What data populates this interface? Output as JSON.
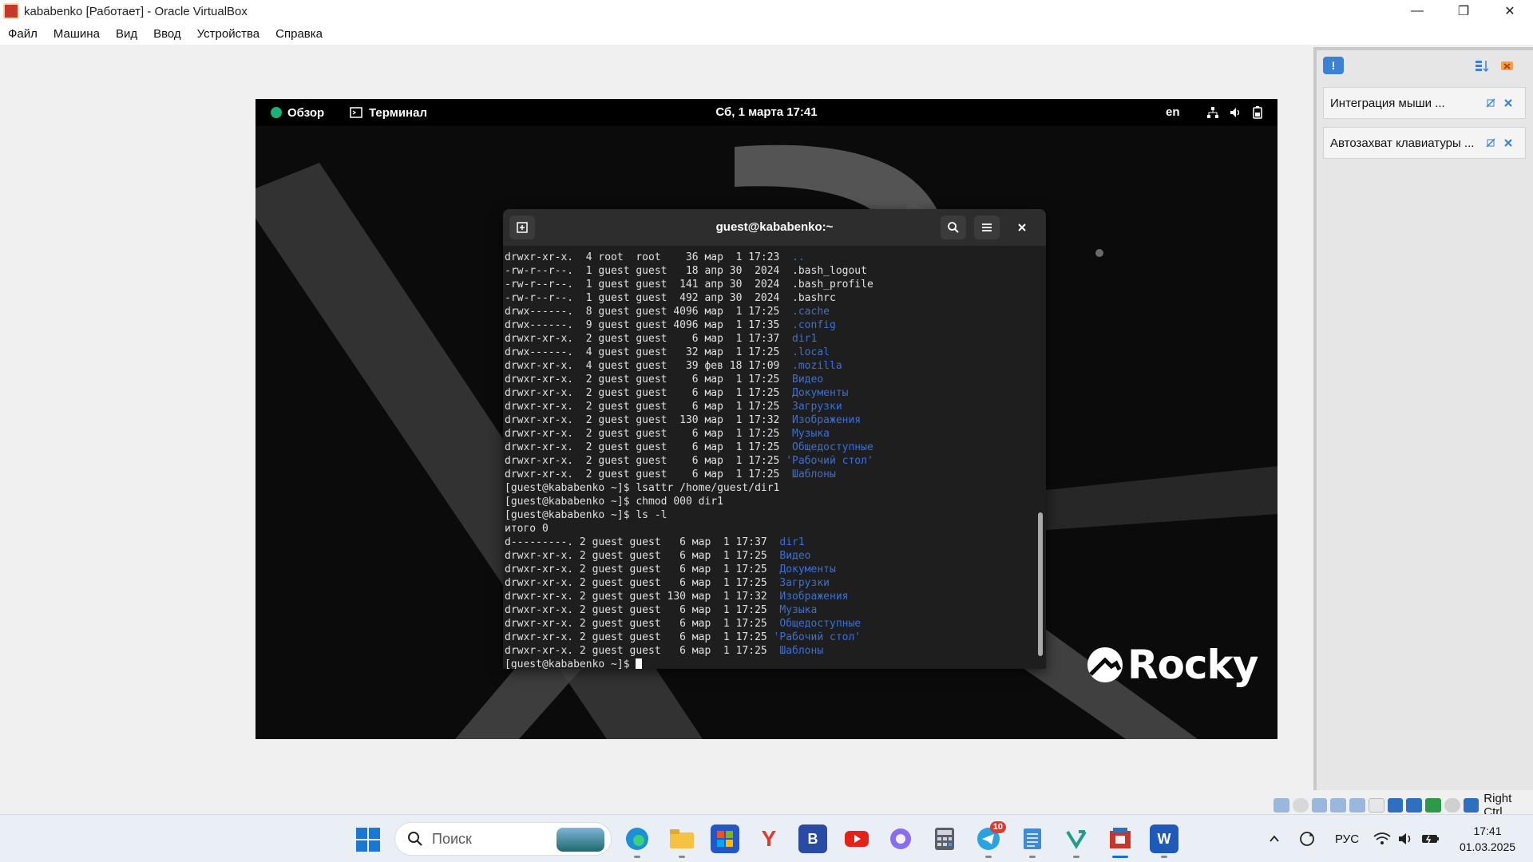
{
  "window": {
    "title": "kababenko [Работает] - Oracle VirtualBox",
    "controls": [
      "minimize",
      "restore",
      "close"
    ]
  },
  "menu": [
    "Файл",
    "Машина",
    "Вид",
    "Ввод",
    "Устройства",
    "Справка"
  ],
  "guest": {
    "topbar": {
      "overview": "Обзор",
      "app": "Терминал",
      "datetime": "Сб, 1 марта  17:41",
      "lang": "en"
    },
    "logo_text": "Rocky",
    "terminal": {
      "title": "guest@kababenko:~",
      "lines": [
        {
          "text": "drwxr-xr-x.  4 root  root    36 мар  1 17:23  ",
          "name": ".."
        },
        {
          "text": "-rw-r--r--.  1 guest guest   18 апр 30  2024  .bash_logout",
          "name": ""
        },
        {
          "text": "-rw-r--r--.  1 guest guest  141 апр 30  2024  .bash_profile",
          "name": ""
        },
        {
          "text": "-rw-r--r--.  1 guest guest  492 апр 30  2024  .bashrc",
          "name": ""
        },
        {
          "text": "drwx------.  8 guest guest 4096 мар  1 17:25  ",
          "name": ".cache"
        },
        {
          "text": "drwx------.  9 guest guest 4096 мар  1 17:35  ",
          "name": ".config"
        },
        {
          "text": "drwxr-xr-x.  2 guest guest    6 мар  1 17:37  ",
          "name": "dir1"
        },
        {
          "text": "drwx------.  4 guest guest   32 мар  1 17:25  ",
          "name": ".local"
        },
        {
          "text": "drwxr-xr-x.  4 guest guest   39 фев 18 17:09  ",
          "name": ".mozilla"
        },
        {
          "text": "drwxr-xr-x.  2 guest guest    6 мар  1 17:25  ",
          "name": "Видео"
        },
        {
          "text": "drwxr-xr-x.  2 guest guest    6 мар  1 17:25  ",
          "name": "Документы"
        },
        {
          "text": "drwxr-xr-x.  2 guest guest    6 мар  1 17:25  ",
          "name": "Загрузки"
        },
        {
          "text": "drwxr-xr-x.  2 guest guest  130 мар  1 17:32  ",
          "name": "Изображения"
        },
        {
          "text": "drwxr-xr-x.  2 guest guest    6 мар  1 17:25  ",
          "name": "Музыка"
        },
        {
          "text": "drwxr-xr-x.  2 guest guest    6 мар  1 17:25  ",
          "name": "Общедоступные"
        },
        {
          "text": "drwxr-xr-x.  2 guest guest    6 мар  1 17:25 ",
          "name": "'Рабочий стол'"
        },
        {
          "text": "drwxr-xr-x.  2 guest guest    6 мар  1 17:25  ",
          "name": "Шаблоны"
        },
        {
          "text": "[guest@kababenko ~]$ lsattr /home/guest/dir1",
          "name": ""
        },
        {
          "text": "[guest@kababenko ~]$ chmod 000 dir1",
          "name": ""
        },
        {
          "text": "[guest@kababenko ~]$ ls -l",
          "name": ""
        },
        {
          "text": "итого 0",
          "name": ""
        },
        {
          "text": "d---------. 2 guest guest   6 мар  1 17:37  ",
          "name": "dir1"
        },
        {
          "text": "drwxr-xr-x. 2 guest guest   6 мар  1 17:25  ",
          "name": "Видео"
        },
        {
          "text": "drwxr-xr-x. 2 guest guest   6 мар  1 17:25  ",
          "name": "Документы"
        },
        {
          "text": "drwxr-xr-x. 2 guest guest   6 мар  1 17:25  ",
          "name": "Загрузки"
        },
        {
          "text": "drwxr-xr-x. 2 guest guest 130 мар  1 17:32  ",
          "name": "Изображения"
        },
        {
          "text": "drwxr-xr-x. 2 guest guest   6 мар  1 17:25  ",
          "name": "Музыка"
        },
        {
          "text": "drwxr-xr-x. 2 guest guest   6 мар  1 17:25  ",
          "name": "Общедоступные"
        },
        {
          "text": "drwxr-xr-x. 2 guest guest   6 мар  1 17:25 ",
          "name": "'Рабочий стол'"
        },
        {
          "text": "drwxr-xr-x. 2 guest guest   6 мар  1 17:25  ",
          "name": "Шаблоны"
        }
      ],
      "prompt": "[guest@kababenko ~]$ "
    }
  },
  "side_panel": {
    "items": [
      {
        "label": "Интеграция мыши ..."
      },
      {
        "label": "Автозахват клавиатуры ..."
      }
    ]
  },
  "status_bar": {
    "host_key": "Right Ctrl"
  },
  "taskbar": {
    "search_placeholder": "Поиск",
    "telegram_badge": "10",
    "tray_lang": "РУС",
    "time": "17:41",
    "date": "01.03.2025"
  },
  "colors": {
    "accent": "#1a78d4",
    "dir_blue": "#3b6fd6",
    "terminal_bg": "#1e1e1e"
  }
}
